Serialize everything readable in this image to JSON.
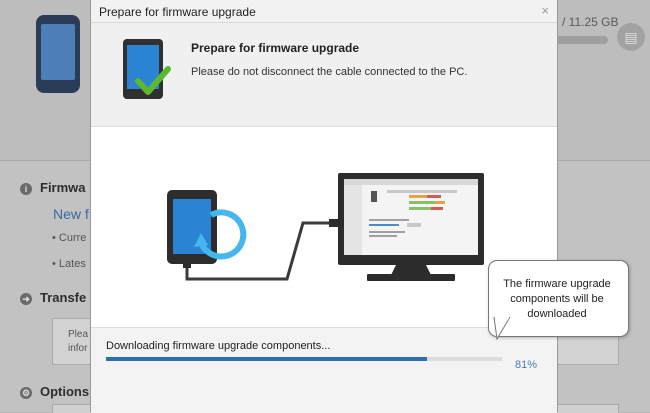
{
  "background": {
    "storage_text": "/ 11.25 GB",
    "sections": [
      {
        "label": "Firmwa"
      },
      {
        "label": "Transfe"
      },
      {
        "label": "Options"
      }
    ],
    "new_firmware_text": "New f",
    "bullets": [
      "Curre",
      "Lates"
    ],
    "box_text_lines": [
      "Plea",
      "infor"
    ]
  },
  "dialog": {
    "title": "Prepare for firmware upgrade",
    "close_symbol": "×",
    "heading": "Prepare for firmware upgrade",
    "subheading": "Please do not disconnect the cable connected to the PC.",
    "status_text": "Downloading firmware upgrade components...",
    "progress": 0.81,
    "progress_label": "81%"
  },
  "tooltip": {
    "lines": [
      "The firmware upgrade",
      "components will be",
      "downloaded"
    ]
  },
  "colors": {
    "accent": "#2f6ea9",
    "check": "#5cb82e",
    "tablet_screen": "#2a83d3"
  },
  "icons": {
    "title_close": "close-icon",
    "header": "tablet-check-icon",
    "sections": [
      "info-icon",
      "transfer-icon",
      "gear-icon"
    ]
  }
}
